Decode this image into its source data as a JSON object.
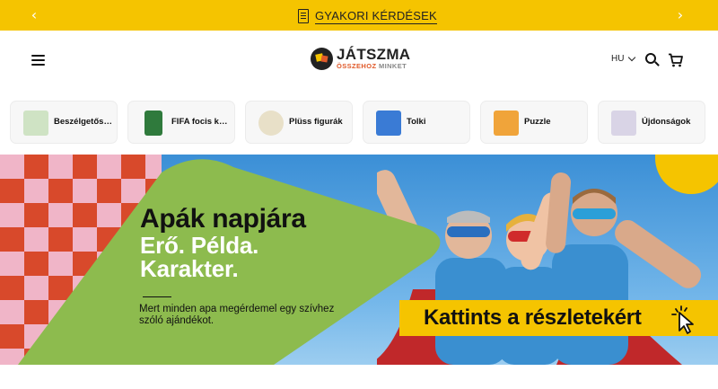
{
  "announcement": {
    "text": "GYAKORI KÉRDÉSEK",
    "prev_icon": "chevron-left-icon",
    "next_icon": "chevron-right-icon",
    "doc_icon": "document-icon"
  },
  "header": {
    "logo_main": "JÁTSZMA",
    "logo_sub_1": "ÖSSZEHOZ",
    "logo_sub_2": "MINKET",
    "lang": "HU",
    "menu_icon": "hamburger-menu-icon",
    "search_icon": "search-icon",
    "cart_icon": "cart-icon"
  },
  "categories": [
    {
      "label": "Beszélgetős, ...",
      "thumb_color": "#cfe3c4"
    },
    {
      "label": "FIFA focis kár...",
      "thumb_color": "#2f7a3c"
    },
    {
      "label": "Plüss figurák",
      "thumb_color": "#e8e0c8"
    },
    {
      "label": "Tolki",
      "thumb_color": "#3a7bd5"
    },
    {
      "label": "Puzzle",
      "thumb_color": "#f0a43a"
    },
    {
      "label": "Újdonságok",
      "thumb_color": "#d9d4e6"
    }
  ],
  "hero": {
    "line1": "Apák napjára",
    "line2": "Erő. Példa.",
    "line3": "Karakter.",
    "subtitle": "Mert minden apa megérdemel egy szívhez szóló ajándékot.",
    "cta": "Kattints a részletekért",
    "colors": {
      "green": "#8dbb4e",
      "yellow": "#f5c400",
      "red": "#d8492b",
      "pink": "#f0b5c8",
      "sky": "#5aa5e0"
    }
  }
}
